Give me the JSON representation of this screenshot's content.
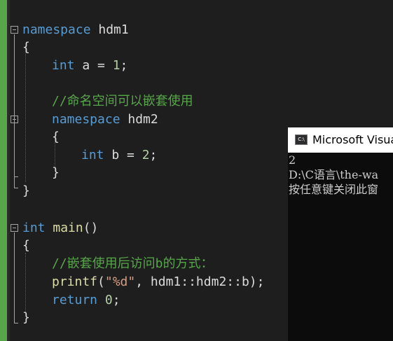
{
  "theme": {
    "background": "#1e1e1e",
    "keyword": "#569cd6",
    "comment": "#57a64a",
    "number": "#b5cea8",
    "string": "#d69d85",
    "function": "#dcdcaa",
    "plain": "#dcdcdc"
  },
  "code": {
    "kw_namespace": "namespace",
    "ns_outer": " hdm1",
    "open_brace": "{",
    "close_brace": "}",
    "kw_int": "int",
    "var_a_assign": " a = ",
    "num_1": "1",
    "semicolon": ";",
    "comment_nested": "//命名空间可以嵌套使用",
    "ns_inner": " hdm2",
    "var_b_assign": " b = ",
    "num_2": "2",
    "main_sig": "main",
    "parens": "()",
    "comment_access": "//嵌套使用后访问b的方式：",
    "printf_fn": "printf",
    "printf_open": "(",
    "printf_fmt": "\"%d\"",
    "printf_args": ", hdm1::hdm2::b);",
    "kw_return": "return",
    "return_val": "0",
    "space": " "
  },
  "console": {
    "title": "Microsoft Visual",
    "icon_label": "C:\\",
    "output_lines": [
      "2",
      "D:\\C语言\\the-wa",
      "按任意键关闭此窗"
    ]
  }
}
